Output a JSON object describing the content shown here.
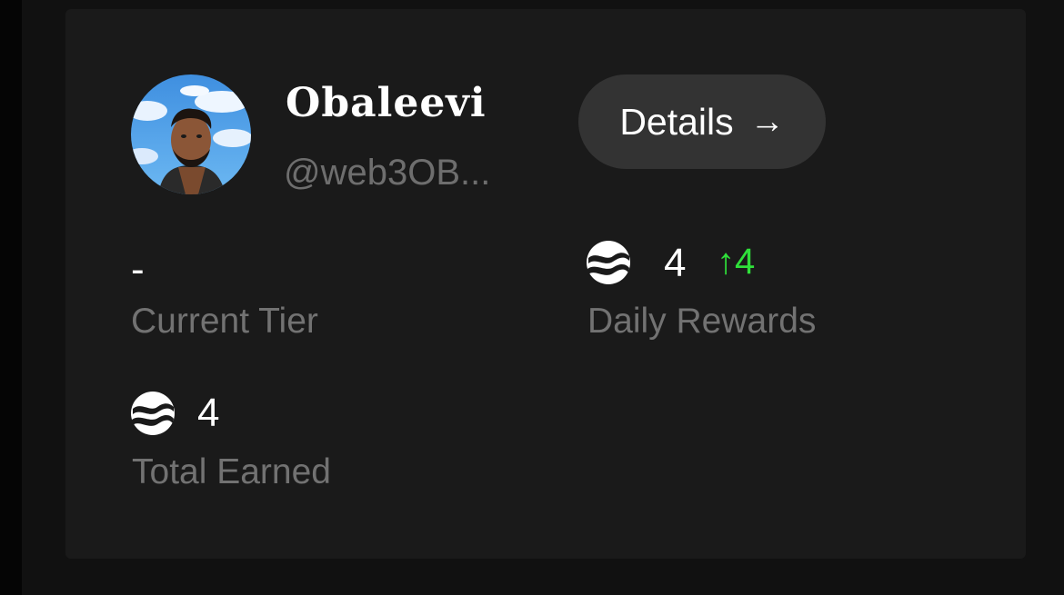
{
  "profile": {
    "display_name": "Obaleevi",
    "handle": "@web3OB..."
  },
  "details_button": {
    "label": "Details",
    "icon": "arrow-right-icon",
    "arrow": "→"
  },
  "stats": {
    "current_tier": {
      "value": "-",
      "label": "Current Tier"
    },
    "daily_rewards": {
      "icon": "token-coin-icon",
      "value": "4",
      "delta_arrow": "↑",
      "delta": "4",
      "label": "Daily Rewards"
    },
    "total_earned": {
      "icon": "token-coin-icon",
      "value": "4",
      "label": "Total Earned"
    }
  },
  "colors": {
    "background": "#111111",
    "card": "#1a1a1a",
    "button": "#333333",
    "text_primary": "#ffffff",
    "text_secondary": "#727272",
    "positive": "#2fe03a"
  }
}
